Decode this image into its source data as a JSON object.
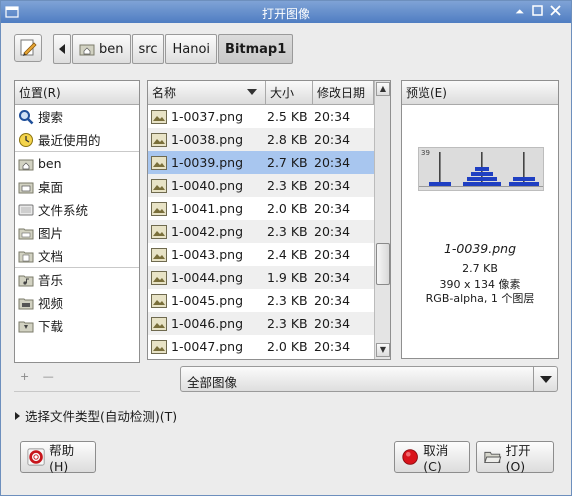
{
  "window": {
    "title": "打开图像"
  },
  "pathbar": {
    "segments": [
      "ben",
      "src",
      "Hanoi",
      "Bitmap1"
    ]
  },
  "places": {
    "header": "位置(R)",
    "items": [
      {
        "label": "搜索",
        "icon": "search-icon"
      },
      {
        "label": "最近使用的",
        "icon": "recent-icon"
      },
      {
        "label": "ben",
        "icon": "home-folder-icon"
      },
      {
        "label": "桌面",
        "icon": "desktop-folder-icon"
      },
      {
        "label": "文件系统",
        "icon": "drive-icon"
      },
      {
        "label": "图片",
        "icon": "folder-icon"
      },
      {
        "label": "文档",
        "icon": "folder-icon"
      },
      {
        "label": "音乐",
        "icon": "folder-icon"
      },
      {
        "label": "视频",
        "icon": "folder-icon"
      },
      {
        "label": "下载",
        "icon": "folder-icon"
      }
    ]
  },
  "files": {
    "columns": {
      "name": "名称",
      "size": "大小",
      "modified": "修改日期"
    },
    "rows": [
      {
        "name": "1-0037.png",
        "size": "2.5 KB",
        "modified": "20:34"
      },
      {
        "name": "1-0038.png",
        "size": "2.8 KB",
        "modified": "20:34"
      },
      {
        "name": "1-0039.png",
        "size": "2.7 KB",
        "modified": "20:34"
      },
      {
        "name": "1-0040.png",
        "size": "2.3 KB",
        "modified": "20:34"
      },
      {
        "name": "1-0041.png",
        "size": "2.0 KB",
        "modified": "20:34"
      },
      {
        "name": "1-0042.png",
        "size": "2.3 KB",
        "modified": "20:34"
      },
      {
        "name": "1-0043.png",
        "size": "2.4 KB",
        "modified": "20:34"
      },
      {
        "name": "1-0044.png",
        "size": "1.9 KB",
        "modified": "20:34"
      },
      {
        "name": "1-0045.png",
        "size": "2.3 KB",
        "modified": "20:34"
      },
      {
        "name": "1-0046.png",
        "size": "2.3 KB",
        "modified": "20:34"
      },
      {
        "name": "1-0047.png",
        "size": "2.0 KB",
        "modified": "20:34"
      }
    ],
    "selected_index": 2
  },
  "preview": {
    "header": "预览(E)",
    "thumb_label": "39",
    "filename": "1-0039.png",
    "size": "2.7 KB",
    "dimensions": "390 x 134 像素",
    "info": "RGB-alpha, 1 个图层"
  },
  "filter": {
    "selected": "全部图像"
  },
  "expander": {
    "label": "选择文件类型(自动检测)(T)"
  },
  "buttons": {
    "help": "帮助(H)",
    "cancel": "取消(C)",
    "open": "打开(O)"
  },
  "colors": {
    "selection": "#a8c6ef",
    "titlebar": "#5a86c8",
    "cancel_red": "#d9131b"
  }
}
